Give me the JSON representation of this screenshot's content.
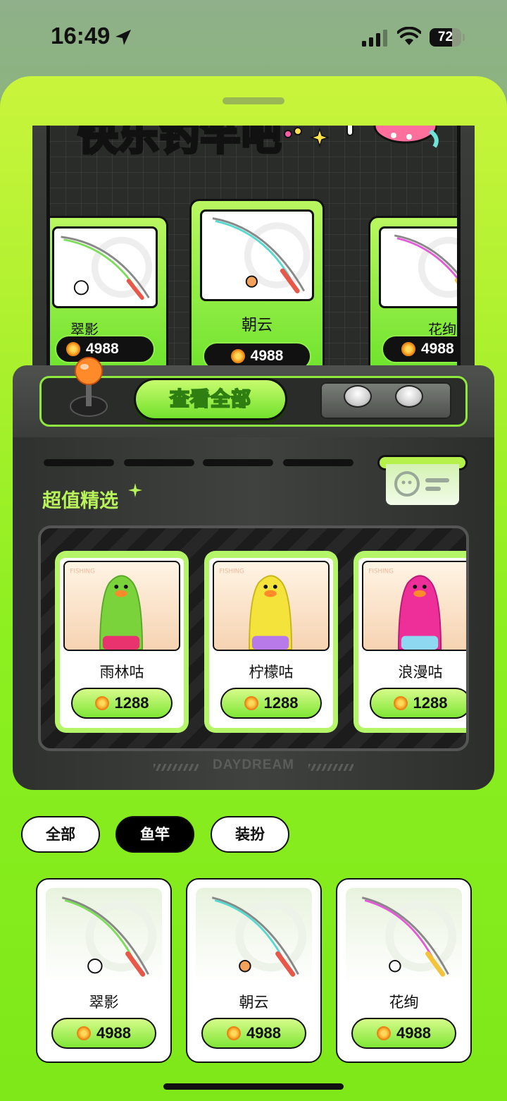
{
  "status_bar": {
    "time": "16:49",
    "battery": "72",
    "battery_level": 0.72
  },
  "banner": {
    "text": "快乐钓竿吧"
  },
  "reel": {
    "items": [
      {
        "name": "翠影",
        "price": "4988"
      },
      {
        "name": "朝云",
        "price": "4988"
      },
      {
        "name": "花绚",
        "price": "4988"
      }
    ]
  },
  "controls": {
    "view_all_label": "查看全部"
  },
  "featured": {
    "title": "超值精选",
    "items": [
      {
        "name": "雨林咕",
        "price": "1288",
        "color": "#7ad33a"
      },
      {
        "name": "柠檬咕",
        "price": "1288",
        "color": "#f4e33a"
      },
      {
        "name": "浪漫咕",
        "price": "1288",
        "color": "#ee2f9a"
      }
    ]
  },
  "brand": "DAYDREAM",
  "tabs": [
    {
      "label": "全部",
      "active": false
    },
    {
      "label": "鱼竿",
      "active": true
    },
    {
      "label": "装扮",
      "active": false
    }
  ],
  "products": [
    {
      "name": "翠影",
      "price": "4988"
    },
    {
      "name": "朝云",
      "price": "4988"
    },
    {
      "name": "花绚",
      "price": "4988"
    }
  ],
  "colors": {
    "accent": "#8ef020",
    "dark": "#2b2d2b"
  }
}
